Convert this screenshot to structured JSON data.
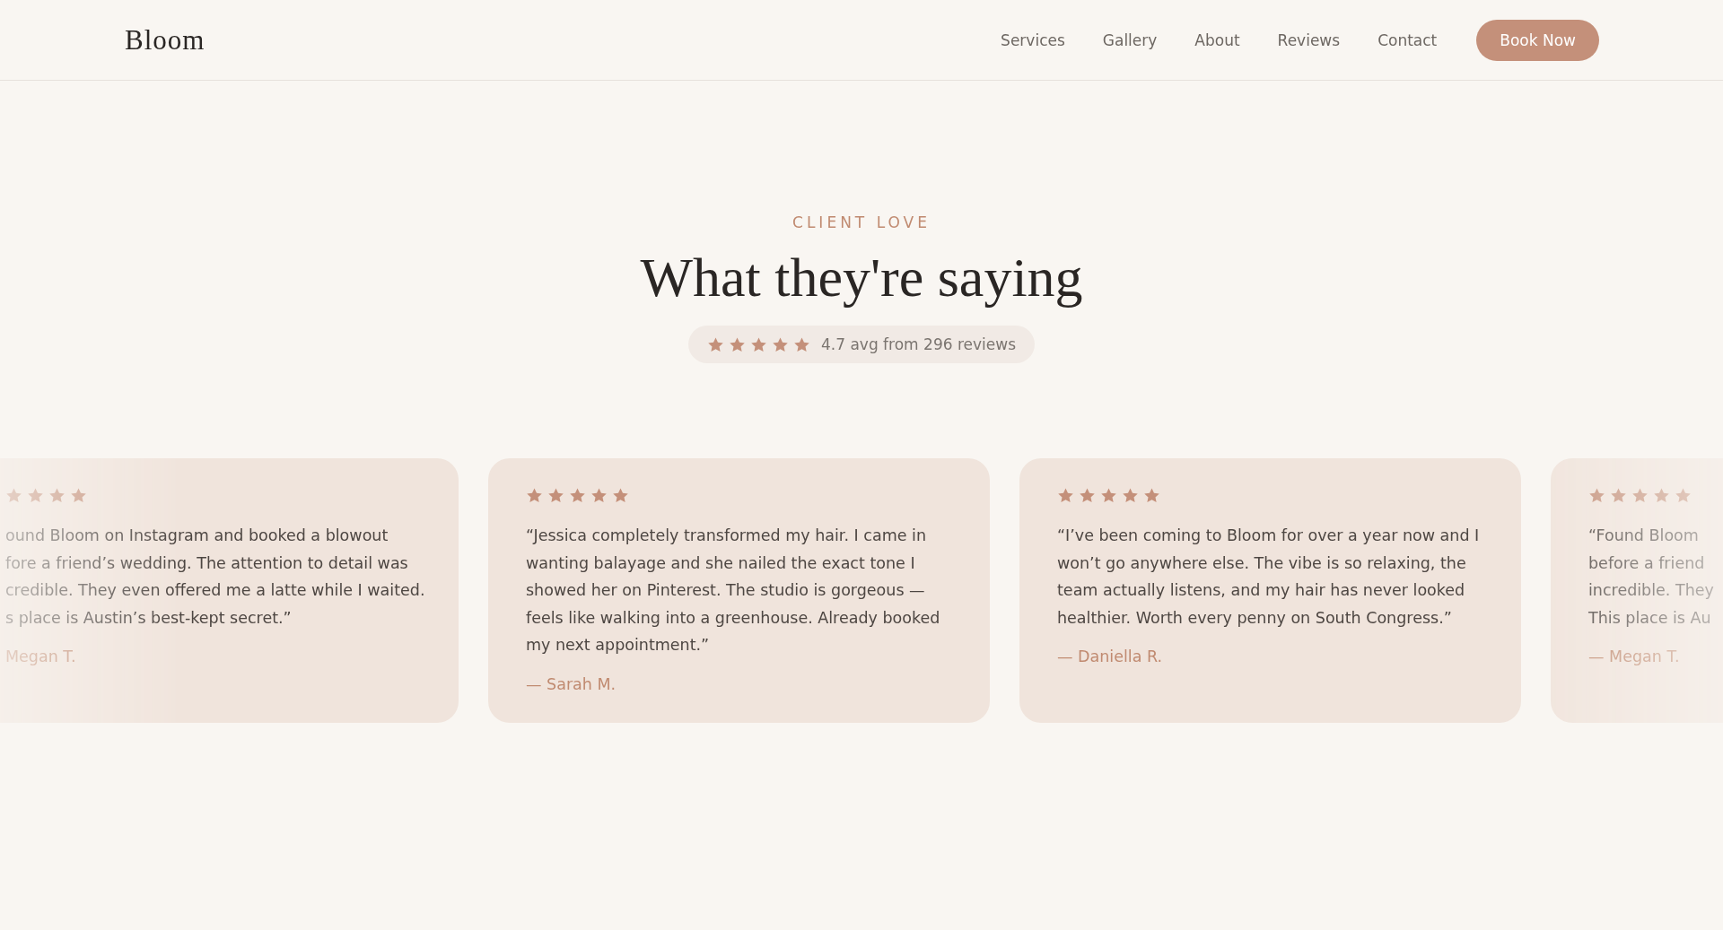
{
  "nav": {
    "logo": "Bloom",
    "links": [
      "Services",
      "Gallery",
      "About",
      "Reviews",
      "Contact"
    ],
    "cta": "Book Now"
  },
  "section": {
    "eyebrow": "CLIENT LOVE",
    "title": "What they're saying",
    "rating": {
      "stars": 5,
      "text": "4.7 avg from 296 reviews"
    }
  },
  "reviews": [
    {
      "kind": "partial-left",
      "stars": 4,
      "lines": [
        "ound Bloom on Instagram and booked a blowout",
        "fore a friend’s wedding. The attention to detail was",
        "credible. They even offered me a latte while I waited.",
        "s place is Austin’s best-kept secret.”"
      ],
      "author": "Megan T."
    },
    {
      "kind": "full",
      "stars": 5,
      "text": "“Jessica completely transformed my hair. I came in wanting balayage and she nailed the exact tone I showed her on Pinterest. The studio is gorgeous — feels like walking into a greenhouse. Already booked my next appointment.”",
      "author": "— Sarah M."
    },
    {
      "kind": "full",
      "stars": 5,
      "text": "“I’ve been coming to Bloom for over a year now and I won’t go anywhere else. The vibe is so relaxing, the team actually listens, and my hair has never looked healthier. Worth every penny on South Congress.”",
      "author": "— Daniella R."
    },
    {
      "kind": "partial-right",
      "stars": 5,
      "lines": [
        "“Found Bloom",
        "before a friend",
        "incredible. They",
        "This place is Au"
      ],
      "author": "— Megan T."
    }
  ]
}
